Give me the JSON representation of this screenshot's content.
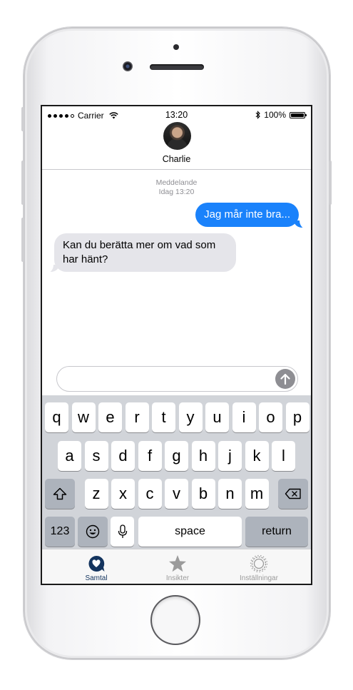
{
  "status_bar": {
    "carrier": "Carrier",
    "time": "13:20",
    "battery": "100%"
  },
  "header": {
    "contact_name": "Charlie"
  },
  "thread": {
    "timestamp_line1": "Meddelande",
    "timestamp_line2": "Idag 13:20",
    "messages": [
      {
        "direction": "outgoing",
        "text": "Jag mår inte bra..."
      },
      {
        "direction": "incoming",
        "text": "Kan du berätta mer om vad som har hänt?"
      }
    ]
  },
  "composer": {
    "value": "",
    "placeholder": ""
  },
  "keyboard": {
    "row1": [
      "q",
      "w",
      "e",
      "r",
      "t",
      "y",
      "u",
      "i",
      "o",
      "p"
    ],
    "row2": [
      "a",
      "s",
      "d",
      "f",
      "g",
      "h",
      "j",
      "k",
      "l"
    ],
    "row3": [
      "z",
      "x",
      "c",
      "v",
      "b",
      "n",
      "m"
    ],
    "numbers_label": "123",
    "space_label": "space",
    "return_label": "return"
  },
  "tabbar": {
    "tabs": [
      {
        "label": "Samtal",
        "icon": "chat-heart-icon",
        "active": true
      },
      {
        "label": "Insikter",
        "icon": "star-icon",
        "active": false
      },
      {
        "label": "Inställningar",
        "icon": "gear-icon",
        "active": false
      }
    ]
  },
  "colors": {
    "accent": "#1a82fb",
    "tab_active": "#13345e",
    "tab_inactive": "#9b9b9b",
    "incoming_bubble": "#e5e5ea",
    "keyboard_bg": "#d1d4d9"
  }
}
